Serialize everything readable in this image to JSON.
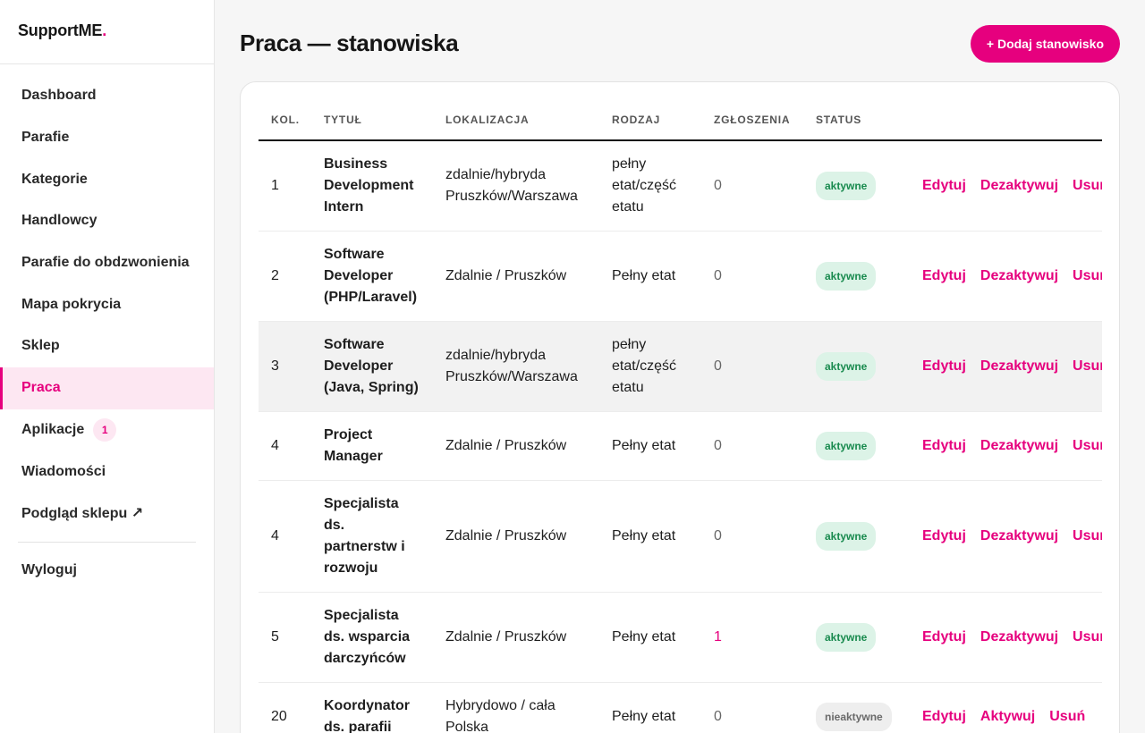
{
  "brand": {
    "name": "SupportME",
    "dot": "."
  },
  "sidebar": {
    "items": [
      {
        "label": "Dashboard"
      },
      {
        "label": "Parafie"
      },
      {
        "label": "Kategorie"
      },
      {
        "label": "Handlowcy"
      },
      {
        "label": "Parafie do obdzwonienia"
      },
      {
        "label": "Mapa pokrycia"
      },
      {
        "label": "Sklep"
      },
      {
        "label": "Praca",
        "active": true
      },
      {
        "label": "Aplikacje",
        "badge": "1"
      },
      {
        "label": "Wiadomości"
      },
      {
        "label": "Podgląd sklepu ↗"
      }
    ],
    "logout": "Wyloguj"
  },
  "header": {
    "title": "Praca — stanowiska",
    "add_button": "+ Dodaj stanowisko"
  },
  "table": {
    "columns": [
      "KOL.",
      "TYTUŁ",
      "LOKALIZACJA",
      "RODZAJ",
      "ZGŁOSZENIA",
      "STATUS",
      ""
    ],
    "rows": [
      {
        "order": "1",
        "title": "Business Development Intern",
        "location": "zdalnie/hybryda Pruszków/Warszawa",
        "type": "pełny etat/część etatu",
        "applications": "0",
        "status": "aktywne",
        "active": true,
        "actions": [
          "Edytuj",
          "Dezaktywuj",
          "Usuń"
        ]
      },
      {
        "order": "2",
        "title": "Software Developer (PHP/Laravel)",
        "location": "Zdalnie / Pruszków",
        "type": "Pełny etat",
        "applications": "0",
        "status": "aktywne",
        "active": true,
        "actions": [
          "Edytuj",
          "Dezaktywuj",
          "Usuń"
        ]
      },
      {
        "order": "3",
        "title": "Software Developer (Java, Spring)",
        "location": "zdalnie/hybryda Pruszków/Warszawa",
        "type": "pełny etat/część etatu",
        "applications": "0",
        "status": "aktywne",
        "active": true,
        "highlighted": true,
        "actions": [
          "Edytuj",
          "Dezaktywuj",
          "Usuń"
        ]
      },
      {
        "order": "4",
        "title": "Project Manager",
        "location": "Zdalnie / Pruszków",
        "type": "Pełny etat",
        "applications": "0",
        "status": "aktywne",
        "active": true,
        "actions": [
          "Edytuj",
          "Dezaktywuj",
          "Usuń"
        ]
      },
      {
        "order": "4",
        "title": "Specjalista ds. partnerstw i rozwoju",
        "location": "Zdalnie / Pruszków",
        "type": "Pełny etat",
        "applications": "0",
        "status": "aktywne",
        "active": true,
        "actions": [
          "Edytuj",
          "Dezaktywuj",
          "Usuń"
        ]
      },
      {
        "order": "5",
        "title": "Specjalista ds. wsparcia darczyńców",
        "location": "Zdalnie / Pruszków",
        "type": "Pełny etat",
        "applications": "1",
        "status": "aktywne",
        "active": true,
        "actions": [
          "Edytuj",
          "Dezaktywuj",
          "Usuń"
        ]
      },
      {
        "order": "20",
        "title": "Koordynator ds. parafii",
        "location": "Hybrydowo / cała Polska",
        "type": "Pełny etat",
        "applications": "0",
        "status": "nieaktywne",
        "active": false,
        "actions": [
          "Edytuj",
          "Aktywuj",
          "Usuń"
        ]
      }
    ]
  },
  "colors": {
    "accent": "#e6007e",
    "accent_soft": "#fde7f2",
    "status_active_bg": "#dcf3e7",
    "status_active_fg": "#188a4e",
    "status_inactive_bg": "#eeeeee"
  }
}
